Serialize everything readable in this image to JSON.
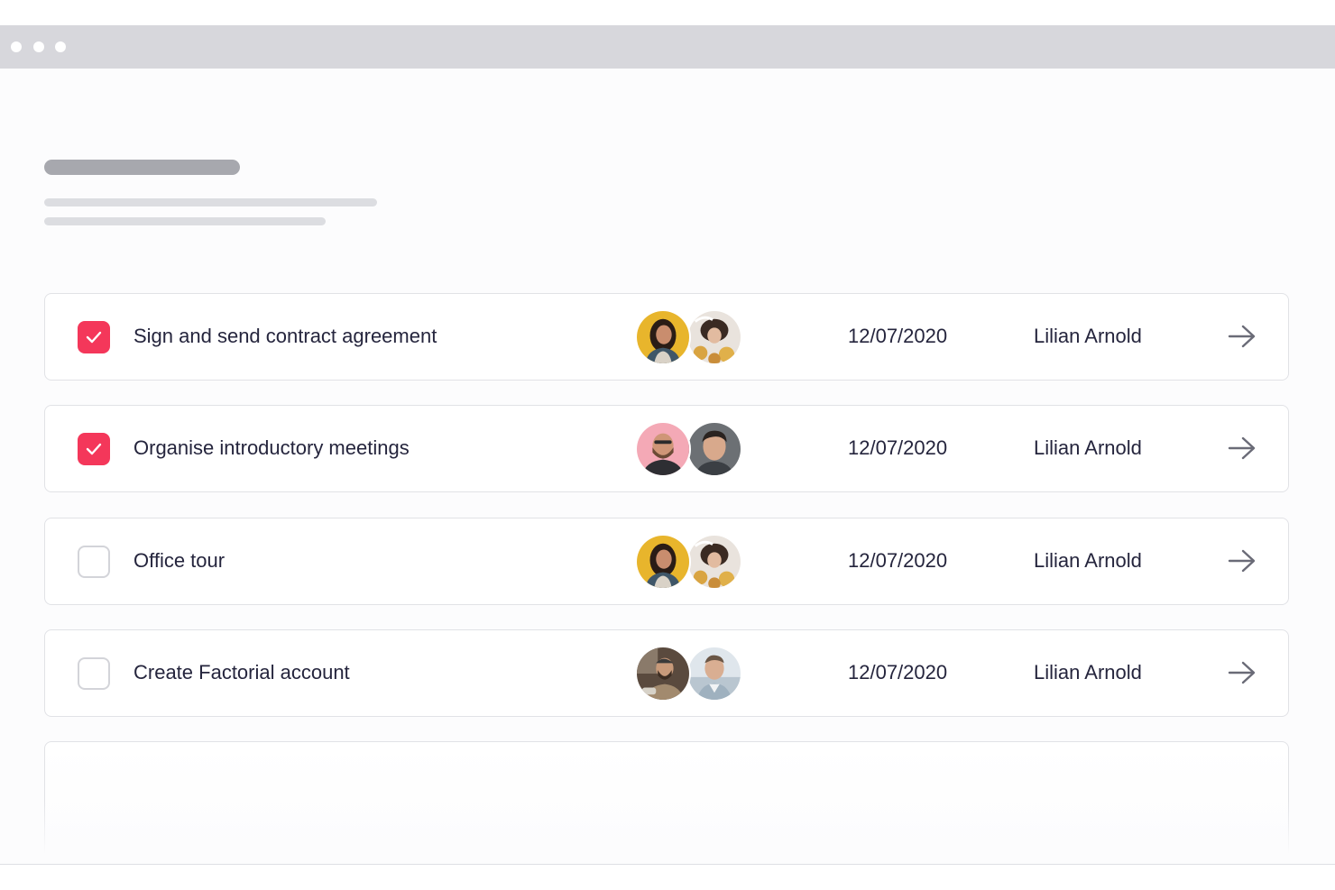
{
  "colors": {
    "accent": "#f4375a",
    "titlebar": "#d7d7dc",
    "text": "#25253d",
    "border": "#e1e2e6"
  },
  "tasks": [
    {
      "label": "Sign and send contract agreement",
      "checked": true,
      "date": "12/07/2020",
      "assignee": "Lilian Arnold",
      "avatars": [
        "avatar-woman-yellow-bg",
        "avatar-woman-lying-flowers"
      ]
    },
    {
      "label": "Organise introductory meetings",
      "checked": true,
      "date": "12/07/2020",
      "assignee": "Lilian Arnold",
      "avatars": [
        "avatar-bearded-man-pink-bg",
        "avatar-man-dark-bg"
      ]
    },
    {
      "label": "Office tour",
      "checked": false,
      "date": "12/07/2020",
      "assignee": "Lilian Arnold",
      "avatars": [
        "avatar-woman-yellow-bg",
        "avatar-woman-lying-flowers"
      ]
    },
    {
      "label": "Create Factorial account",
      "checked": false,
      "date": "12/07/2020",
      "assignee": "Lilian Arnold",
      "avatars": [
        "avatar-man-cafe",
        "avatar-man-outdoor"
      ]
    }
  ],
  "icons": {
    "check": "check-icon",
    "arrow": "arrow-right-icon"
  }
}
